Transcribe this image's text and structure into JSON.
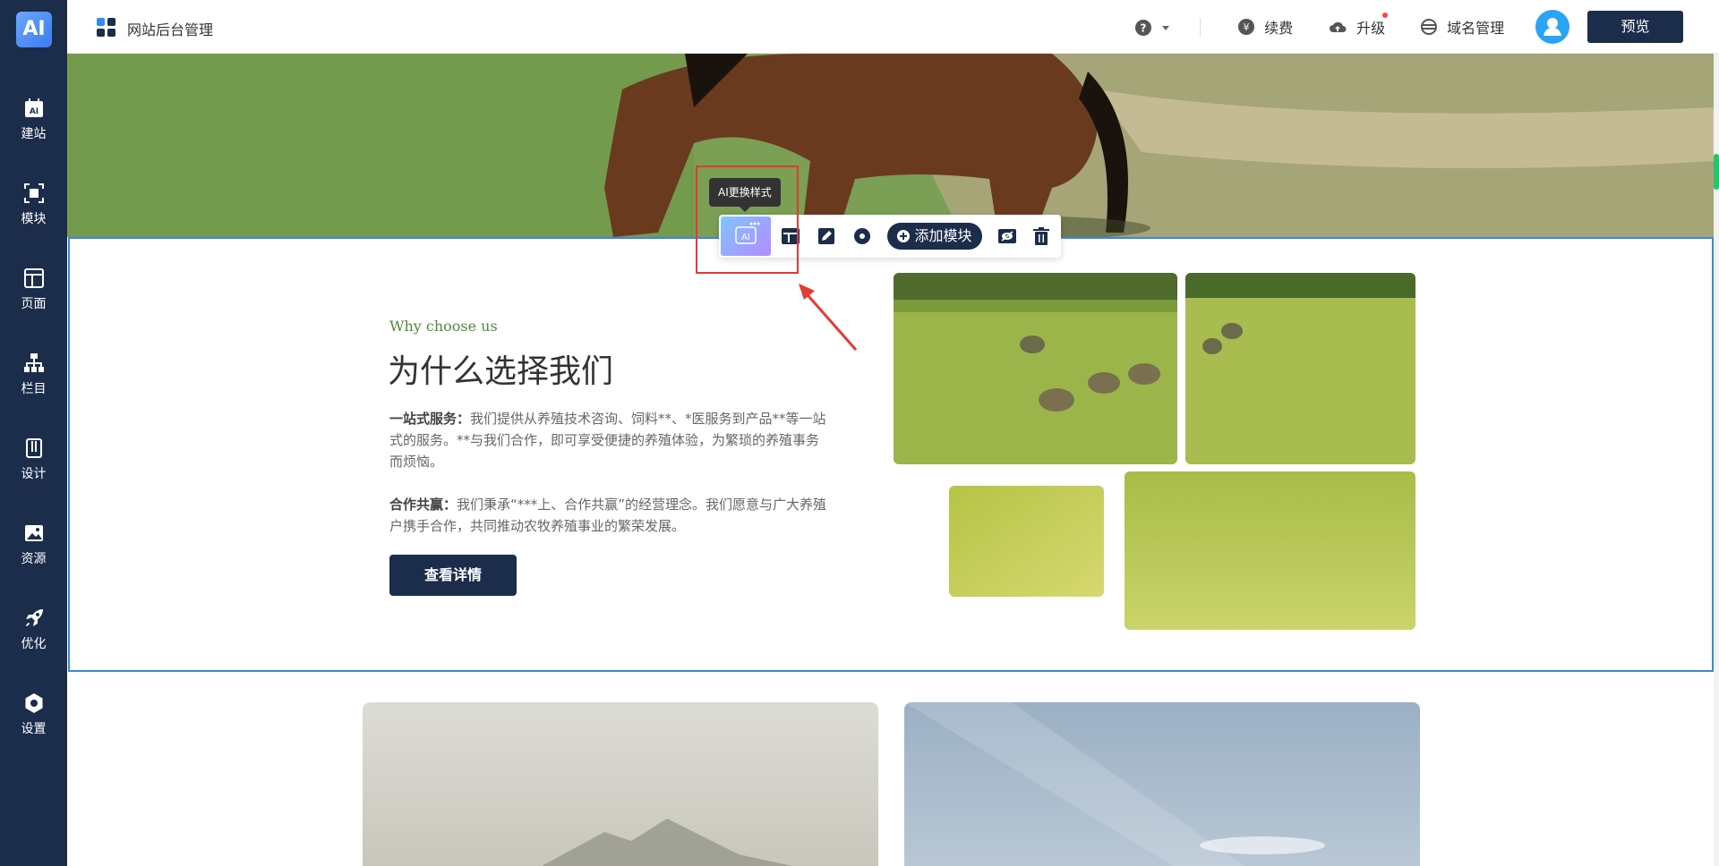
{
  "sidebar": {
    "logo": "AI",
    "items": [
      {
        "label": "建站",
        "icon": "ai-build-icon"
      },
      {
        "label": "模块",
        "icon": "module-icon"
      },
      {
        "label": "页面",
        "icon": "page-icon"
      },
      {
        "label": "栏目",
        "icon": "sitemap-icon"
      },
      {
        "label": "设计",
        "icon": "design-icon"
      },
      {
        "label": "资源",
        "icon": "image-resource-icon"
      },
      {
        "label": "优化",
        "icon": "rocket-icon"
      },
      {
        "label": "设置",
        "icon": "gear-icon"
      }
    ]
  },
  "topbar": {
    "brand": "网站后台管理",
    "renew": "续费",
    "upgrade": "升级",
    "domain": "域名管理",
    "preview": "预览"
  },
  "toolbar": {
    "tooltip": "AI更换样式",
    "ai_label": "AI",
    "add_module": "添加模块"
  },
  "section": {
    "kicker": "Why choose us",
    "title": "为什么选择我们",
    "para1_bold": "一站式服务：",
    "para1": "我们提供从养殖技术咨询、饲料**、*医服务到产品**等一站式的服务。**与我们合作，即可享受便捷的养殖体验，为繁琐的养殖事务而烦恼。",
    "para2_bold": "合作共赢：",
    "para2": "我们秉承“***上、合作共赢”的经营理念。我们愿意与广大养殖户携手合作，共同推动农牧养殖事业的繁荣发展。",
    "button": "查看详情"
  },
  "colors": {
    "sidebar": "#1b2d4b",
    "accent_blue": "#3c86e0",
    "highlight_red": "#e53935",
    "kicker_green": "#4f8a3a"
  }
}
